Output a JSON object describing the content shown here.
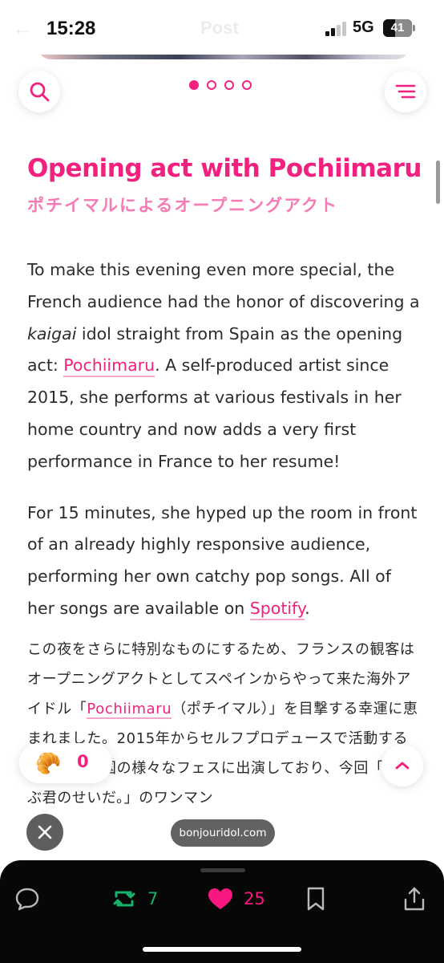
{
  "status_bar": {
    "time": "15:28",
    "faint_title": "Post",
    "network": "5G",
    "battery": "41",
    "battery_level": 0.41
  },
  "carousel": {
    "total_slides": 4,
    "active_slide": 1
  },
  "article": {
    "heading": "Opening act with Pochiimaru",
    "subheading": "ポチイマルによるオープニングアクト",
    "paragraph1": {
      "part1": "To make this evening even more special, the French audience had the honor of discovering a ",
      "italic": "kaigai",
      "part2": " idol straight from Spain as the opening act: ",
      "link": "Pochiimaru",
      "part3": ". A self-produced artist since 2015, she performs at various festivals in her home country and now adds a very first performance in France to her resume!"
    },
    "paragraph2": {
      "part1": "For 15 minutes, she hyped up the room in front of an already highly responsive audience, performing her own catchy pop songs. All of her songs are available on ",
      "link": "Spotify",
      "part2": "."
    },
    "paragraph_ja": {
      "part1": "この夜をさらに特別なものにするため、フランスの観客はオープニングアクトとしてスペインからやって来た海外アイドル「",
      "link": "Pochiimaru",
      "part2": "（ポチイマル）」を目撃する幸運に恵まれました。2015年からセルフプロデュースで活動する彼女は、母国の様々なフェスに出演しており、今回「ぜんぶ君のせいだ。」のワンマン"
    }
  },
  "floating": {
    "reaction_emoji": "🥐",
    "reaction_count": "0",
    "domain": "bonjouridol.com"
  },
  "toolbar": {
    "repost_count": "7",
    "like_count": "25"
  },
  "colors": {
    "accent": "#f2217f",
    "accent_light": "#f77ab4",
    "repost": "#15b36b",
    "like": "#f91880",
    "toolbar_bg": "#070707"
  },
  "icons": [
    "back-arrow-icon",
    "search-icon",
    "menu-icon",
    "chevron-up-icon",
    "close-icon",
    "reply-icon",
    "repost-icon",
    "heart-icon",
    "bookmark-icon",
    "share-icon"
  ]
}
